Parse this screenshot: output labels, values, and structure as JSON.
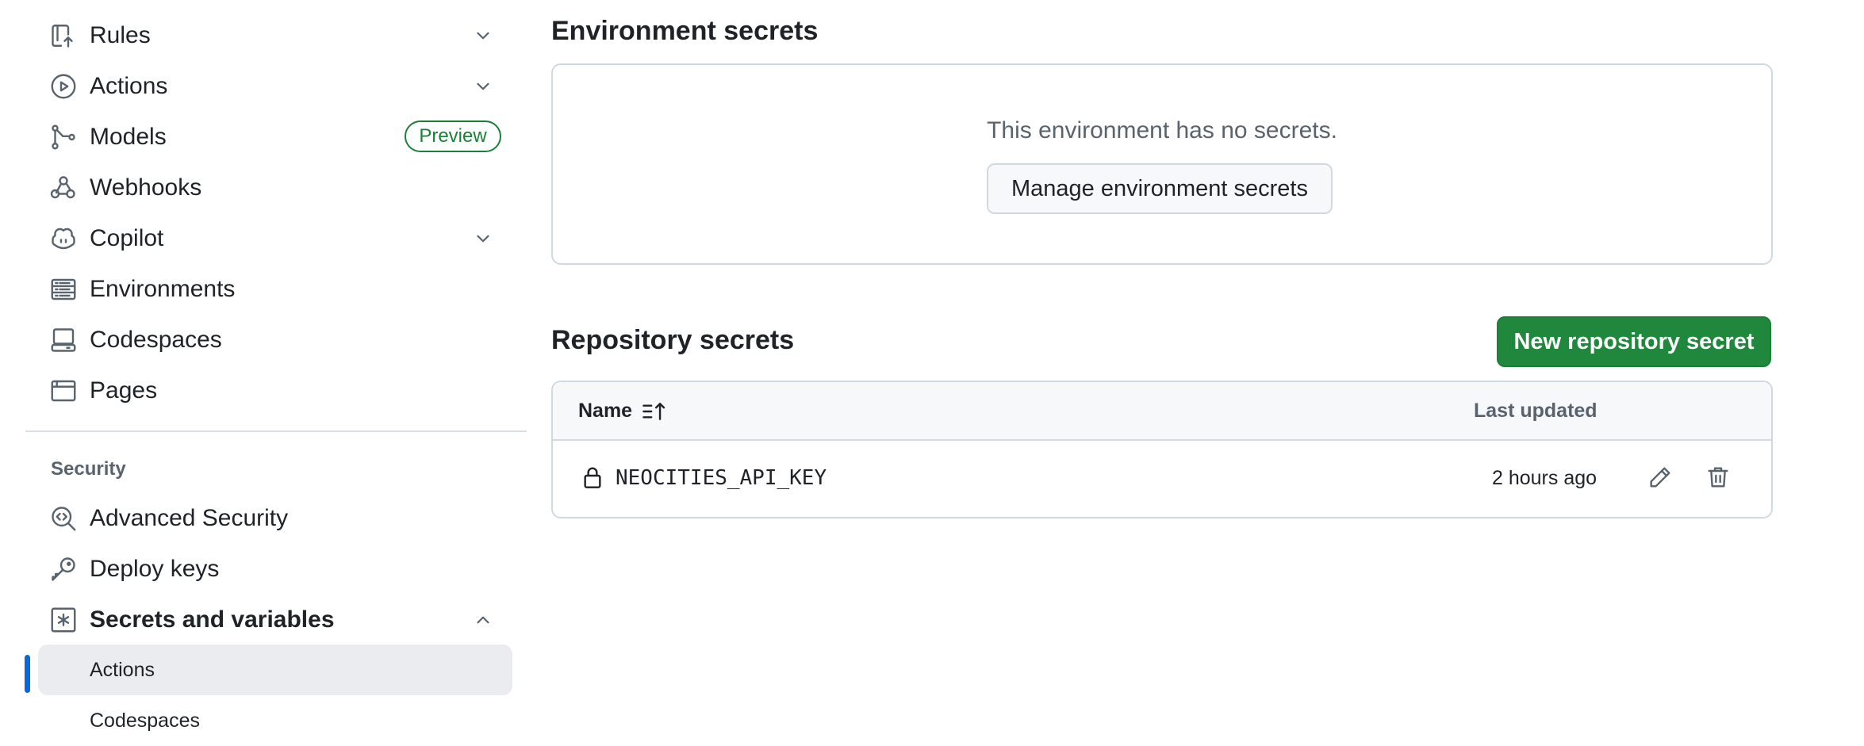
{
  "sidebar": {
    "items": [
      {
        "label": "Rules",
        "icon": "rules-icon",
        "has_chevron": true
      },
      {
        "label": "Actions",
        "icon": "play-icon",
        "has_chevron": true
      },
      {
        "label": "Models",
        "icon": "models-icon",
        "badge": "Preview"
      },
      {
        "label": "Webhooks",
        "icon": "webhook-icon"
      },
      {
        "label": "Copilot",
        "icon": "copilot-icon",
        "has_chevron": true
      },
      {
        "label": "Environments",
        "icon": "server-icon"
      },
      {
        "label": "Codespaces",
        "icon": "codespaces-icon"
      },
      {
        "label": "Pages",
        "icon": "browser-icon"
      }
    ],
    "security_heading": "Security",
    "security_items": [
      {
        "label": "Advanced Security",
        "icon": "codescan-icon"
      },
      {
        "label": "Deploy keys",
        "icon": "key-icon"
      },
      {
        "label": "Secrets and variables",
        "icon": "asterisk-icon",
        "expanded": true
      }
    ],
    "sub_items": [
      {
        "label": "Actions",
        "active": true
      },
      {
        "label": "Codespaces",
        "active": false
      }
    ]
  },
  "environment_secrets": {
    "title": "Environment secrets",
    "empty_message": "This environment has no secrets.",
    "manage_button": "Manage environment secrets"
  },
  "repository_secrets": {
    "title": "Repository secrets",
    "new_button": "New repository secret",
    "columns": {
      "name": "Name",
      "last_updated": "Last updated"
    },
    "rows": [
      {
        "name": "NEOCITIES_API_KEY",
        "last_updated": "2 hours ago"
      }
    ]
  },
  "colors": {
    "accent": "#0969da",
    "primary_button": "#1f883d",
    "preview_badge": "#1a7f37"
  }
}
